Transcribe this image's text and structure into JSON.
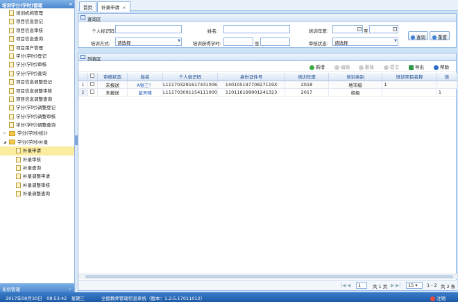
{
  "sidebar": {
    "title": "培训学分(学时)管理",
    "items": [
      {
        "label": "培训机构管理",
        "level": 1
      },
      {
        "label": "项目信息登记",
        "level": 1
      },
      {
        "label": "项目信息审核",
        "level": 1
      },
      {
        "label": "项目信息查询",
        "level": 1
      },
      {
        "label": "项目用户管理",
        "level": 1
      },
      {
        "label": "学分(学时)登记",
        "level": 1
      },
      {
        "label": "学分(学时)审核",
        "level": 1
      },
      {
        "label": "学分(学时)查询",
        "level": 1
      },
      {
        "label": "项目信息调整登记",
        "level": 1
      },
      {
        "label": "项目信息调整审核",
        "level": 1
      },
      {
        "label": "项目信息调整查询",
        "level": 1
      },
      {
        "label": "学分(学时)调整登记",
        "level": 1
      },
      {
        "label": "学分(学时)调整审核",
        "level": 1
      },
      {
        "label": "学分(学时)调整查询",
        "level": 1
      },
      {
        "label": "学分(学时)统计",
        "level": 1,
        "folder": true,
        "expanded": false
      },
      {
        "label": "学分(学时)补录",
        "level": 1,
        "folder": true,
        "expanded": true
      },
      {
        "label": "补录申请",
        "level": 2,
        "selected": true
      },
      {
        "label": "补录审核",
        "level": 2
      },
      {
        "label": "补录查询",
        "level": 2
      },
      {
        "label": "补录调整申请",
        "level": 2
      },
      {
        "label": "补录调整审核",
        "level": 2
      },
      {
        "label": "补录调整查询",
        "level": 2
      }
    ],
    "footer": "系统管理"
  },
  "tabs": [
    {
      "label": "首页",
      "active": false
    },
    {
      "label": "补录申请",
      "active": true,
      "close": "×"
    }
  ],
  "query": {
    "title": "查询区",
    "fields": {
      "id_label": "个人标识码:",
      "name_label": "姓名:",
      "year_label": "培训年度:",
      "year_to": "至",
      "method_label": "培训方式:",
      "method_value": "请选择",
      "hours_label": "培训获得学时:",
      "hours_to": "至",
      "status_label": "审核状态:",
      "status_value": "请选择"
    },
    "buttons": {
      "search": "查询",
      "reset": "重置"
    }
  },
  "list": {
    "title": "列表区",
    "toolbar": {
      "add": "新增",
      "edit": "编辑",
      "delete": "删除",
      "submit": "提交",
      "export": "导出",
      "help": "帮助"
    },
    "columns": [
      "审核状态",
      "姓名",
      "个人标识码",
      "身份证件号",
      "培训年度",
      "培训类别",
      "培训项目名称",
      "培"
    ],
    "rows": [
      {
        "no": "1",
        "status": "未报送",
        "name": "A张三！",
        "id": "L111703291617431006",
        "idcard": "14010519770827119X",
        "year": "2018",
        "category": "地市级",
        "project": "1",
        "extra": ""
      },
      {
        "no": "2",
        "status": "未报送",
        "name": "留天啸",
        "id": "L111703091154111000",
        "idcard": "110116199901241323",
        "year": "2017",
        "category": "校级",
        "project": "",
        "extra": "1"
      }
    ],
    "pager": {
      "page": "1",
      "total_pages": "共 1 页",
      "page_size": "15",
      "range": "1 - 2",
      "total": "共 2 条"
    }
  },
  "status_bar": {
    "datetime": "2017年08月30日　08:53:42　星期三",
    "system": "全国教师管理信息系统（版本：1.2.5.17011012）",
    "logout": "注销"
  },
  "colors": {
    "accent": "#4c86cc",
    "status_bar": "#1e5aa6",
    "selected": "#fbeca0"
  }
}
